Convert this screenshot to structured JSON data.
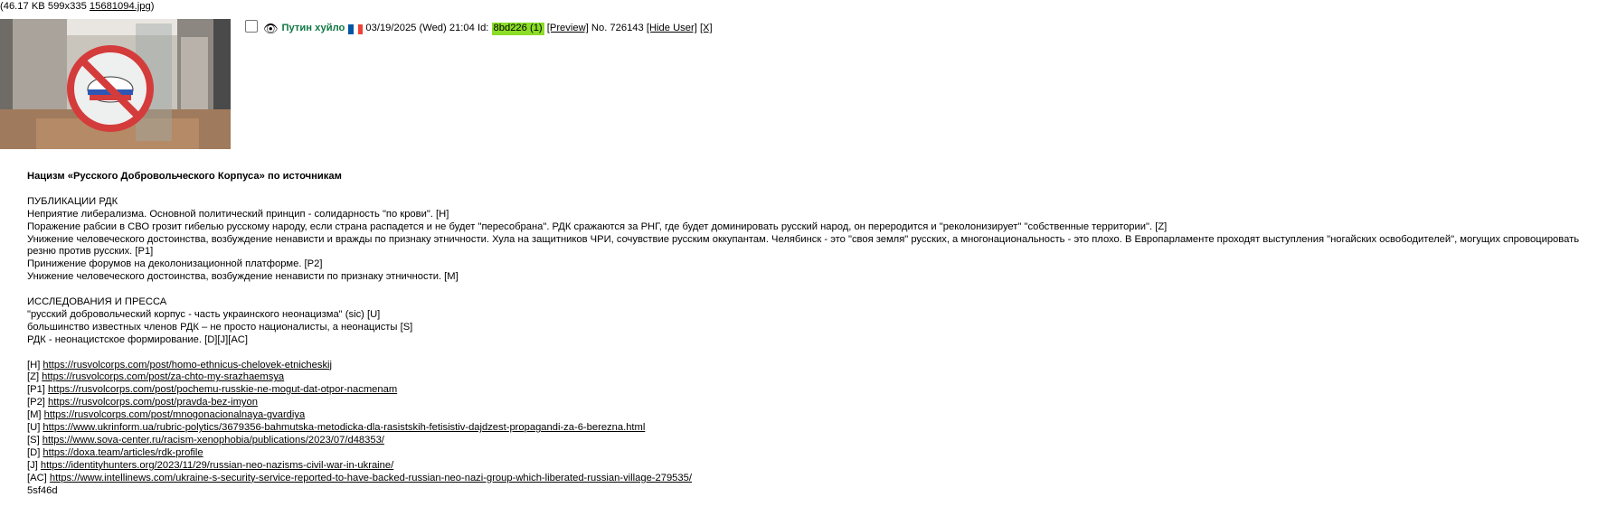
{
  "file": {
    "meta": "(46.17 KB 599x335 ",
    "filename": "15681094.jpg",
    "close_paren": ")"
  },
  "post": {
    "poster_name": "Путин хуйло",
    "datetime": "03/19/2025 (Wed) 21:04",
    "id_label": "Id:",
    "id_value": "8bd226 (1)",
    "preview": "[Preview]",
    "number": "No. 726143",
    "hide_user": "[Hide User]",
    "close": "[X]",
    "flag_colors": [
      "#0055a4",
      "#ffffff",
      "#ef4135"
    ],
    "eye_icon": "eye-icon"
  },
  "content": {
    "title": "Нацизм «Русского Добровольческого Корпуса» по источникам",
    "section1_heading": "ПУБЛИКАЦИИ РДК",
    "section1_lines": [
      "Неприятие либерализма. Основной политический принцип - солидарность \"по крови\". [H]",
      "Поражение рабсии в СВО грозит гибелью русскому народу, если страна распадется и не будет \"пересобрана\". РДК сражаются за РНГ, где будет доминировать русский народ, он переродится и \"реколонизирует\" \"собственные территории\". [Z]",
      "Унижение человеческого достоинства, возбуждение ненависти и вражды по признаку этничности. Хула на защитников ЧРИ, сочувствие русским оккупантам. Челябинск - это \"своя земля\" русских, а многонациональность - это плохо. В Европарламенте проходят выступления \"ногайских освободителей\", могущих спровоцировать резню против русских. [P1]",
      "Принижение форумов на деколонизационной платформе. [P2]",
      "Унижение человеческого достоинства, возбуждение ненависти по признаку этничности. [M]"
    ],
    "section2_heading": "ИССЛЕДОВАНИЯ И ПРЕССА",
    "section2_lines": [
      "\"русский добровольческий корпус - часть украинского неонацизма\" (sic) [U]",
      "большинство известных членов РДК – не просто националисты, а неонацисты [S]",
      "РДК - неонацистское формирование. [D][J][AC]"
    ],
    "refs": [
      {
        "tag": "[H] ",
        "url": "https://rusvolcorps.com/post/homo-ethnicus-chelovek-etnicheskij"
      },
      {
        "tag": "[Z] ",
        "url": "https://rusvolcorps.com/post/za-chto-my-srazhaemsya"
      },
      {
        "tag": "[P1] ",
        "url": "https://rusvolcorps.com/post/pochemu-russkie-ne-mogut-dat-otpor-nacmenam"
      },
      {
        "tag": "[P2] ",
        "url": "https://rusvolcorps.com/post/pravda-bez-imyon"
      },
      {
        "tag": "[M] ",
        "url": "https://rusvolcorps.com/post/mnogonacionalnaya-gvardiya"
      },
      {
        "tag": "[U] ",
        "url": "https://www.ukrinform.ua/rubric-polytics/3679356-bahmutska-metodicka-dla-rasistskih-fetisistiv-dajdzest-propagandi-za-6-berezna.html"
      },
      {
        "tag": "[S] ",
        "url": "https://www.sova-center.ru/racism-xenophobia/publications/2023/07/d48353/"
      },
      {
        "tag": "[D] ",
        "url": "https://doxa.team/articles/rdk-profile"
      },
      {
        "tag": "[J] ",
        "url": "https://identityhunters.org/2023/11/29/russian-neo-nazisms-civil-war-in-ukraine/"
      },
      {
        "tag": "[AC] ",
        "url": "https://www.intellinews.com/ukraine-s-security-service-reported-to-have-backed-russian-neo-nazi-group-which-liberated-russian-village-279535/"
      }
    ],
    "footer_code": "5sf46d"
  }
}
